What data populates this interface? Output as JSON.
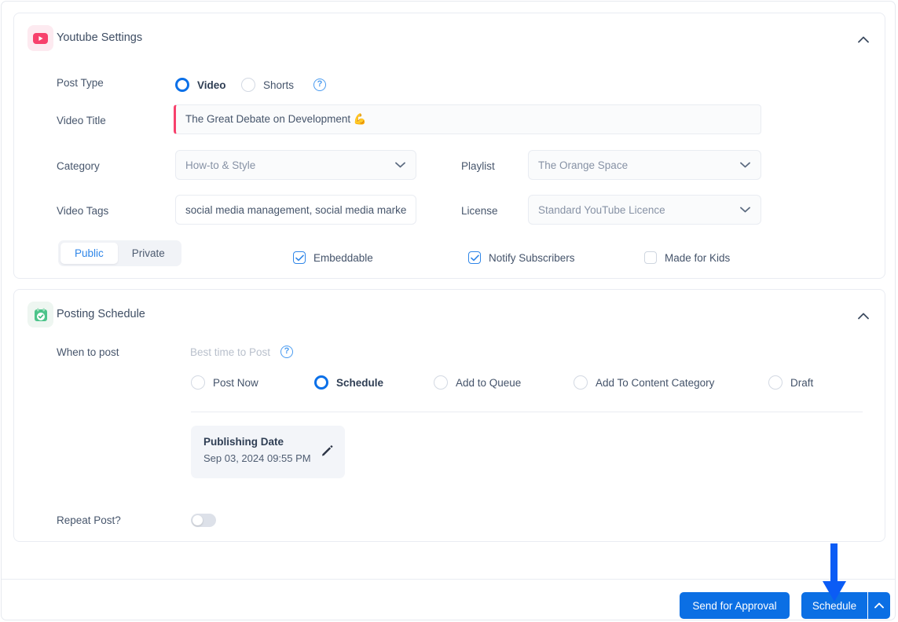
{
  "youtube_panel": {
    "title": "Youtube Settings",
    "icon": "youtube-icon",
    "collapse_icon": "chevron-up-icon",
    "post_type": {
      "label": "Post Type",
      "options": [
        {
          "label": "Video",
          "selected": true
        },
        {
          "label": "Shorts",
          "selected": false
        }
      ],
      "help_icon": "help-circle-icon",
      "help_glyph": "?"
    },
    "video_title": {
      "label": "Video Title",
      "value": "The Great Debate on Development 💪"
    },
    "category": {
      "label": "Category",
      "value": "How-to & Style",
      "caret_icon": "chevron-down-icon"
    },
    "playlist": {
      "label": "Playlist",
      "value": "The Orange Space",
      "caret_icon": "chevron-down-icon"
    },
    "video_tags": {
      "label": "Video Tags",
      "value": "social media management, social media marke"
    },
    "license": {
      "label": "License",
      "value": "Standard YouTube Licence",
      "caret_icon": "chevron-down-icon"
    },
    "visibility": {
      "options": [
        {
          "label": "Public",
          "active": true
        },
        {
          "label": "Private",
          "active": false
        }
      ]
    },
    "checkboxes": [
      {
        "label": "Embeddable",
        "checked": true
      },
      {
        "label": "Notify Subscribers",
        "checked": true
      },
      {
        "label": "Made for Kids",
        "checked": false
      }
    ]
  },
  "schedule_panel": {
    "title": "Posting Schedule",
    "icon": "calendar-check-icon",
    "collapse_icon": "chevron-up-icon",
    "when_to_post": {
      "label": "When to post",
      "best_time_label": "Best time to Post",
      "help_icon": "help-circle-icon",
      "help_glyph": "?"
    },
    "options": [
      {
        "label": "Post Now",
        "selected": false
      },
      {
        "label": "Schedule",
        "selected": true
      },
      {
        "label": "Add to Queue",
        "selected": false
      },
      {
        "label": "Add To Content Category",
        "selected": false
      },
      {
        "label": "Draft",
        "selected": false
      }
    ],
    "publishing_date": {
      "title": "Publishing Date",
      "value": "Sep 03, 2024 09:55 PM",
      "edit_icon": "pencil-icon"
    },
    "repeat_post": {
      "label": "Repeat Post?",
      "enabled": false
    }
  },
  "footer": {
    "send_for_approval_label": "Send for Approval",
    "schedule_label": "Schedule",
    "schedule_caret_icon": "chevron-up-icon"
  },
  "annotation": {
    "arrow_icon": "down-arrow-annotation",
    "color": "#0b5cf5",
    "points_at": "Schedule"
  },
  "colors": {
    "primary_blue": "#0b6fe4",
    "youtube_red": "#f7416c",
    "schedule_green": "#4cc48a",
    "text": "#3f4d61",
    "muted": "#8792a5",
    "panel_border": "#e9ecf2"
  }
}
